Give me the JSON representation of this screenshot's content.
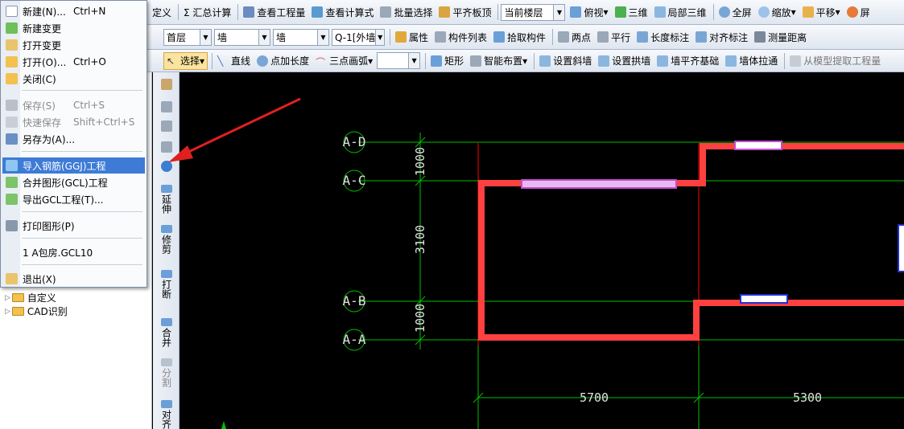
{
  "toolbar1": {
    "items": [
      "定义",
      "Σ 汇总计算",
      "查看工程量",
      "查看计算式",
      "批量选择",
      "平齐板顶"
    ],
    "floor_select": "当前楼层",
    "view_items": [
      "俯视",
      "三维",
      "局部三维",
      "全屏",
      "缩放",
      "平移",
      "屏"
    ]
  },
  "toolbar2": {
    "floor": "首层",
    "category": "墙",
    "type": "墙",
    "component": "Q-1[外墙",
    "items": [
      "属性",
      "构件列表",
      "拾取构件",
      "两点",
      "平行",
      "长度标注",
      "对齐标注",
      "测量距离"
    ]
  },
  "toolbar3": {
    "select": "选择",
    "items": [
      "直线",
      "点加长度",
      "三点画弧"
    ],
    "items2": [
      "矩形",
      "智能布置",
      "设置斜墙",
      "设置拱墙",
      "墙平齐基础",
      "墙体拉通",
      "从模型提取工程量"
    ]
  },
  "menu": {
    "items": [
      {
        "label": "新建(N)...",
        "shortcut": "Ctrl+N",
        "enabled": true
      },
      {
        "label": "新建变更",
        "shortcut": "",
        "enabled": true
      },
      {
        "label": "打开变更",
        "shortcut": "",
        "enabled": true
      },
      {
        "label": "打开(O)...",
        "shortcut": "Ctrl+O",
        "enabled": true
      },
      {
        "label": "关闭(C)",
        "shortcut": "",
        "enabled": true
      },
      {
        "label": "保存(S)",
        "shortcut": "Ctrl+S",
        "enabled": false
      },
      {
        "label": "快速保存",
        "shortcut": "Shift+Ctrl+S",
        "enabled": false
      },
      {
        "label": "另存为(A)...",
        "shortcut": "",
        "enabled": true
      },
      {
        "label": "导入钢筋(GGJ)工程",
        "shortcut": "",
        "enabled": true,
        "highlighted": true
      },
      {
        "label": "合并图形(GCL)工程",
        "shortcut": "",
        "enabled": true
      },
      {
        "label": "导出GCL工程(T)...",
        "shortcut": "",
        "enabled": true
      },
      {
        "label": "打印图形(P)",
        "shortcut": "",
        "enabled": true
      },
      {
        "label": "1 A包房.GCL10",
        "shortcut": "",
        "enabled": true
      },
      {
        "label": "退出(X)",
        "shortcut": "",
        "enabled": true
      }
    ]
  },
  "tree": {
    "items": [
      "自定义",
      "CAD识别"
    ]
  },
  "vertical_tools": [
    "延伸",
    "修剪",
    "打断",
    "合并",
    "分割",
    "对齐"
  ],
  "drawing": {
    "axes": [
      "A-D",
      "A-C",
      "A-B",
      "A-A"
    ],
    "dimensions_vertical": [
      "1000",
      "3100",
      "1000"
    ],
    "dimensions_horizontal": [
      "5700",
      "5300"
    ],
    "wall_color": "#ff4040",
    "axis_color": "#00c000",
    "guide_color": "#ff0000",
    "text_color": "#e0e0e0"
  },
  "colors": {
    "menu_highlight": "#3d7bd6",
    "arrow": "#e02020"
  }
}
